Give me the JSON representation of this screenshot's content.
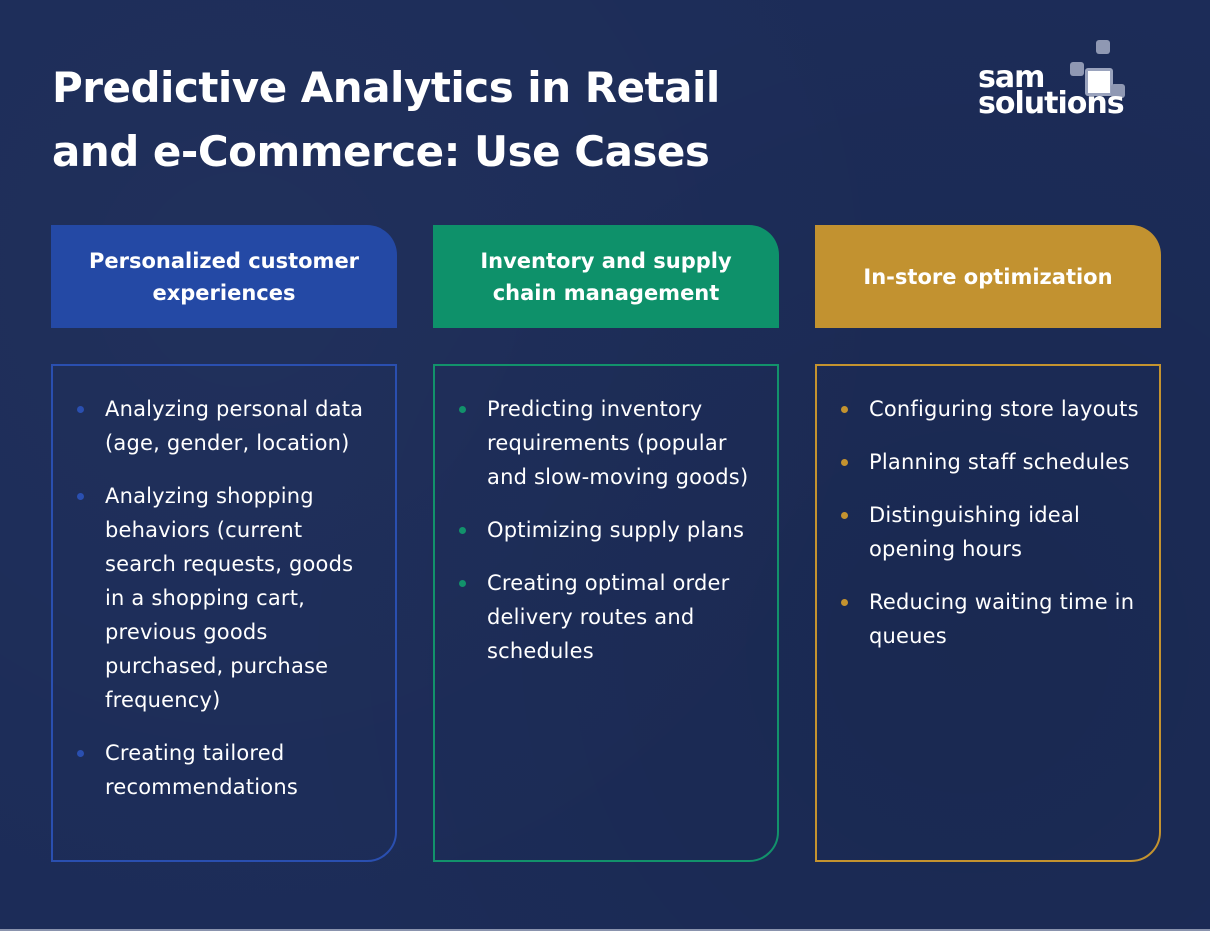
{
  "title": {
    "line1": "Predictive Analytics in Retail",
    "line2": "and e-Commerce: Use Cases"
  },
  "logo": {
    "line1": "sam",
    "line2": "solutions",
    "icon": "stacked-squares-icon"
  },
  "colors": {
    "background": "#1c2c58",
    "blue": "#2449a5",
    "green": "#0e916a",
    "gold": "#c29230"
  },
  "columns": [
    {
      "heading": "Personalized customer experiences",
      "accent": "#2449a5",
      "items": [
        "Analyzing personal data (age, gender, location)",
        "Analyzing shopping behaviors (current search requests, goods in a shopping cart, previous goods purchased, purchase frequency)",
        "Creating tailored recommendations"
      ]
    },
    {
      "heading": "Inventory and supply chain management",
      "accent": "#0e916a",
      "items": [
        "Predicting inventory requirements (popular and slow-moving goods)",
        "Optimizing supply plans",
        "Creating optimal order delivery routes and schedules"
      ]
    },
    {
      "heading": "In-store optimization",
      "accent": "#c29230",
      "items": [
        "Configuring store layouts",
        "Planning staff schedules",
        "Distinguishing ideal opening hours",
        "Reducing waiting time in queues"
      ]
    }
  ]
}
